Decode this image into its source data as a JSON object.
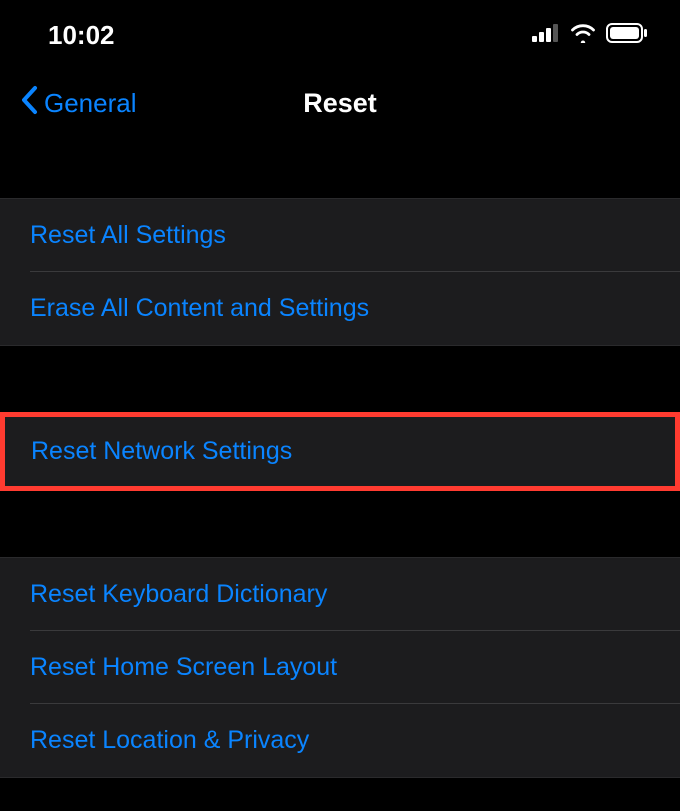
{
  "status": {
    "time": "10:02"
  },
  "nav": {
    "back_label": "General",
    "title": "Reset"
  },
  "group1": {
    "items": [
      {
        "label": "Reset All Settings"
      },
      {
        "label": "Erase All Content and Settings"
      }
    ]
  },
  "highlight": {
    "label": "Reset Network Settings"
  },
  "group3": {
    "items": [
      {
        "label": "Reset Keyboard Dictionary"
      },
      {
        "label": "Reset Home Screen Layout"
      },
      {
        "label": "Reset Location & Privacy"
      }
    ]
  }
}
